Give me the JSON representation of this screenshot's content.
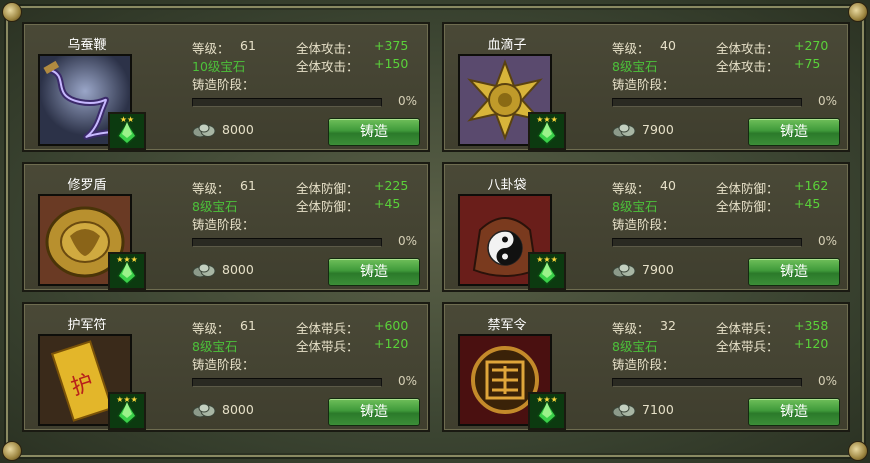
{
  "labels": {
    "level": "等级：",
    "stage": "铸造阶段：",
    "forge_button": "铸造"
  },
  "items": [
    {
      "name": "乌蚕鞭",
      "level": "61",
      "stat1_label": "全体攻击：",
      "stat1_value": "+375",
      "gem_req": "10级宝石",
      "stat2_label": "全体攻击：",
      "stat2_value": "+150",
      "progress": "0%",
      "cost": "8000",
      "stars": "★★",
      "art": "whip"
    },
    {
      "name": "血滴子",
      "level": "40",
      "stat1_label": "全体攻击：",
      "stat1_value": "+270",
      "gem_req": "8级宝石",
      "stat2_label": "全体攻击：",
      "stat2_value": "+75",
      "progress": "0%",
      "cost": "7900",
      "stars": "★★★",
      "art": "blade-disc"
    },
    {
      "name": "修罗盾",
      "level": "61",
      "stat1_label": "全体防御：",
      "stat1_value": "+225",
      "gem_req": "8级宝石",
      "stat2_label": "全体防御：",
      "stat2_value": "+45",
      "progress": "0%",
      "cost": "8000",
      "stars": "★★★",
      "art": "shield"
    },
    {
      "name": "八卦袋",
      "level": "40",
      "stat1_label": "全体防御：",
      "stat1_value": "+162",
      "gem_req": "8级宝石",
      "stat2_label": "全体防御：",
      "stat2_value": "+45",
      "progress": "0%",
      "cost": "7900",
      "stars": "★★★",
      "art": "bagua-bag"
    },
    {
      "name": "护军符",
      "level": "61",
      "stat1_label": "全体带兵：",
      "stat1_value": "+600",
      "gem_req": "8级宝石",
      "stat2_label": "全体带兵：",
      "stat2_value": "+120",
      "progress": "0%",
      "cost": "8000",
      "stars": "★★★",
      "art": "talisman"
    },
    {
      "name": "禁军令",
      "level": "32",
      "stat1_label": "全体带兵：",
      "stat1_value": "+358",
      "gem_req": "8级宝石",
      "stat2_label": "全体带兵：",
      "stat2_value": "+120",
      "progress": "0%",
      "cost": "7100",
      "stars": "★★★",
      "art": "token"
    }
  ],
  "colors": {
    "panel_bg": "#46453a",
    "bonus_green": "#5ad23a",
    "button_green": "#3f9a3a",
    "text": "#e6e0c8"
  }
}
